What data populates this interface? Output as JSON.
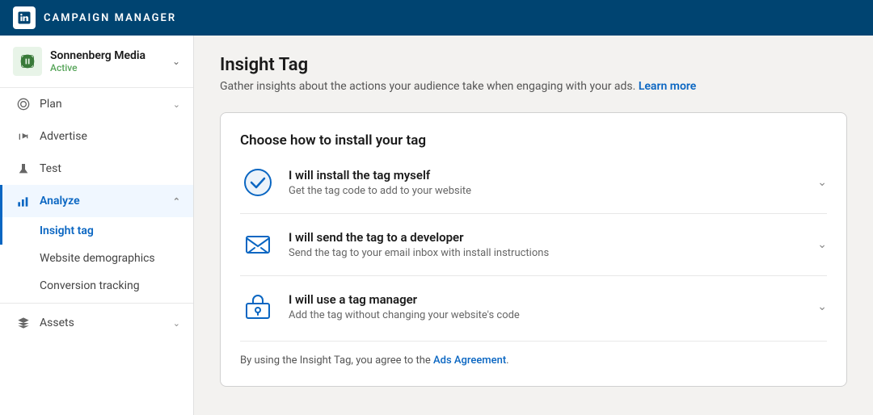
{
  "topbar": {
    "logo_text": "in",
    "title": "CAMPAIGN MANAGER"
  },
  "sidebar": {
    "account": {
      "name": "Sonnenberg Media",
      "status": "Active"
    },
    "nav_items": [
      {
        "id": "plan",
        "label": "Plan",
        "icon": "circle-icon",
        "has_chevron": true,
        "active": false
      },
      {
        "id": "advertise",
        "label": "Advertise",
        "icon": "megaphone-icon",
        "has_chevron": false,
        "active": false
      },
      {
        "id": "test",
        "label": "Test",
        "icon": "flask-icon",
        "has_chevron": false,
        "active": false
      },
      {
        "id": "analyze",
        "label": "Analyze",
        "icon": "chart-icon",
        "has_chevron": true,
        "active": true
      }
    ],
    "sub_items": [
      {
        "id": "insight-tag",
        "label": "Insight tag",
        "active": true
      },
      {
        "id": "website-demographics",
        "label": "Website demographics",
        "active": false
      },
      {
        "id": "conversion-tracking",
        "label": "Conversion tracking",
        "active": false
      }
    ],
    "bottom_items": [
      {
        "id": "assets",
        "label": "Assets",
        "icon": "assets-icon",
        "has_chevron": true,
        "active": false
      }
    ]
  },
  "content": {
    "page_title": "Insight Tag",
    "page_subtitle": "Gather insights about the actions your audience take when engaging with your ads.",
    "learn_more_text": "Learn more",
    "card": {
      "header": "Choose how to install your tag",
      "options": [
        {
          "id": "install-myself",
          "icon": "checkbox-circle-icon",
          "title": "I will install the tag myself",
          "desc": "Get the tag code to add to your website",
          "selected": true
        },
        {
          "id": "send-developer",
          "icon": "email-icon",
          "title": "I will send the tag to a developer",
          "desc": "Send the tag to your email inbox with install instructions",
          "selected": false
        },
        {
          "id": "tag-manager",
          "icon": "briefcase-icon",
          "title": "I will use a tag manager",
          "desc": "Add the tag without changing your website's code",
          "selected": false
        }
      ],
      "footer_text": "By using the Insight Tag, you agree to the",
      "footer_link": "Ads Agreement",
      "footer_end": "."
    }
  }
}
